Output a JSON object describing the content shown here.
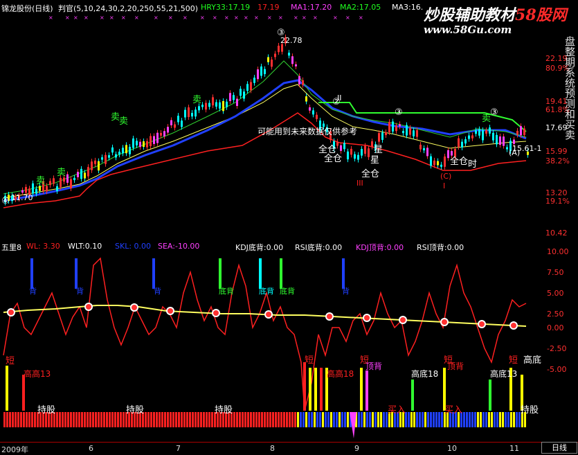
{
  "header": {
    "stock": "锦龙股份(日线)",
    "indicator": "判官(5,10,24,30,2,20,250,55,21,500)",
    "hry": "HRY33:17.19",
    "hry_val": "17.19",
    "ma1": "MA1:17.20",
    "ma2": "MA2:17.05",
    "ma3": "MA3:16."
  },
  "watermark": {
    "white": "炒股辅助教材",
    "red": "58股网",
    "url": "www.58Gu.com"
  },
  "price_axis": [
    "22.19",
    "80.9%",
    "19.41",
    "61.8%",
    "17.69",
    "15.99",
    "38.2%",
    "13.20",
    "19.1%",
    "10.42"
  ],
  "annotations": {
    "high_price": "22.78",
    "low_price": "11.70",
    "low_marker": "④",
    "circle3": "③",
    "circle2": "②",
    "roman2": "II",
    "roman3": "III",
    "roman1": "I",
    "note": "可能用到未来数据仅供参考",
    "sell": "卖",
    "buy": "买",
    "hold": "持",
    "full": "全仓",
    "star": "星",
    "c_label": "(C)",
    "right_low": "15.61-1",
    "right_circle": "(A)",
    "full_right": "全仓",
    "hold_right": "时"
  },
  "sub_header": {
    "name": "五里8",
    "wl": "WL: 3.30",
    "wlt": "WLT:0.10",
    "skl": "SKL: 0.00",
    "sea": "SEA:-10.00",
    "kdj_bottom": "KDJ底背:0.00",
    "rsi_bottom": "RSI底背:0.00",
    "kdj_top": "KDJ顶背:0.00",
    "rsi_top": "RSI顶背:0.00"
  },
  "sub_axis": [
    "10.00",
    "7.50",
    "5.00",
    "2.50",
    "0.00",
    "-2.50",
    "-5.00"
  ],
  "sub_labels": {
    "divergence": [
      "背",
      "背",
      "背",
      "底背",
      "底背",
      "底背",
      "背"
    ],
    "short": [
      "短",
      "短",
      "短",
      "短",
      "短"
    ],
    "high_high": "高高13",
    "high_high2": "高高18",
    "high_bottom": [
      "高底18",
      "高底13"
    ],
    "top_back": [
      "顶背",
      "顶背"
    ],
    "high_bottom_end": "高底",
    "hold_labels": [
      "持股",
      "持股",
      "持股"
    ],
    "buy_in": [
      "买入",
      "买入"
    ],
    "hold_end": "持股"
  },
  "time_axis": [
    "2009年",
    "6",
    "7",
    "8",
    "9",
    "10",
    "11"
  ],
  "status": "日线",
  "side_text": "盘整期系统预测和买卖",
  "chart_data": {
    "type": "candlestick",
    "price_range": [
      10.42,
      22.78
    ],
    "high": 22.78,
    "low": 11.7
  },
  "colors": {
    "red": "#ff2020",
    "green": "#20ff20",
    "blue": "#1a3cff",
    "yellow": "#ffff00",
    "magenta": "#ff40ff",
    "cyan": "#00ffff"
  }
}
